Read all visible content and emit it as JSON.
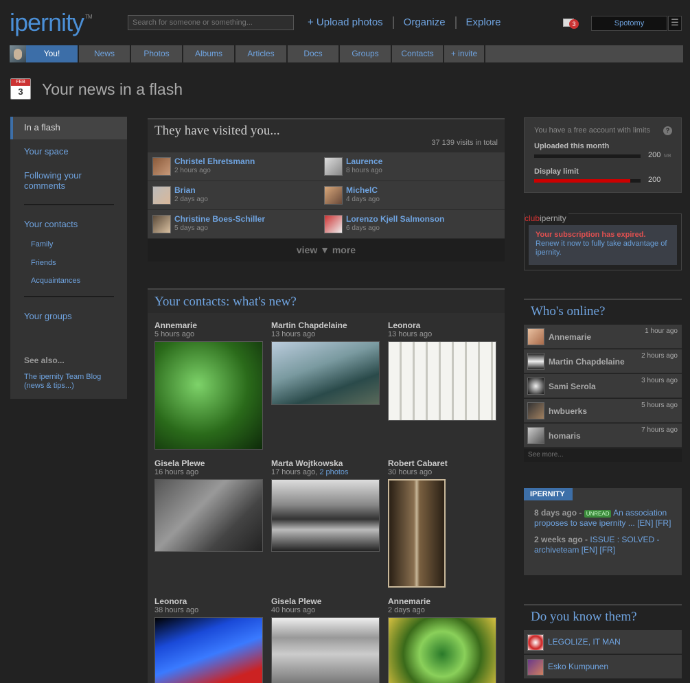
{
  "header": {
    "logo": "ipernity",
    "logo_tm": "TM",
    "search_placeholder": "Search for someone or something...",
    "nav": [
      "+ Upload photos",
      "Organize",
      "Explore"
    ],
    "mail_count": "3",
    "username": "Spotomy",
    "menu_glyph": "☰"
  },
  "tabs": [
    "You!",
    "News",
    "Photos",
    "Albums",
    "Articles",
    "Docs",
    "Groups",
    "Contacts",
    "+ invite"
  ],
  "page": {
    "cal_month": "FEB",
    "cal_day": "3",
    "title": "Your news in a flash"
  },
  "sidebar": {
    "items": [
      "In a flash",
      "Your space",
      "Following your comments",
      "Your contacts",
      "Your groups"
    ],
    "subitems": [
      "Family",
      "Friends",
      "Acquaintances"
    ],
    "see_also": "See also...",
    "blog": "The ipernity Team Blog (news & tips...)"
  },
  "visitors": {
    "title": "They have visited you...",
    "total": "37 139 visits in total",
    "list": [
      {
        "name": "Christel Ehretsmann",
        "time": "2 hours ago"
      },
      {
        "name": "Laurence",
        "time": "8 hours ago"
      },
      {
        "name": "Brian",
        "time": "2 days ago"
      },
      {
        "name": "MichelC",
        "time": "4 days ago"
      },
      {
        "name": "Christine Boes-Schiller",
        "time": "5 days ago"
      },
      {
        "name": "Lorenzo Kjell Salmonson",
        "time": "6 days ago"
      }
    ],
    "view_more": "view ▼ more"
  },
  "contacts": {
    "title": "Your contacts: what's new?",
    "photos": [
      {
        "name": "Annemarie",
        "time": "5 hours ago"
      },
      {
        "name": "Martin Chapdelaine",
        "time": "13 hours ago"
      },
      {
        "name": "Leonora",
        "time": "13 hours ago"
      },
      {
        "name": "Gisela Plewe",
        "time": "16 hours ago"
      },
      {
        "name": "Marta Wojtkowska",
        "time": "17 hours ago,",
        "extra": "2 photos"
      },
      {
        "name": "Robert Cabaret",
        "time": "30 hours ago"
      },
      {
        "name": "Leonora",
        "time": "38 hours ago"
      },
      {
        "name": "Gisela Plewe",
        "time": "40 hours ago"
      },
      {
        "name": "Annemarie",
        "time": "2 days ago"
      }
    ]
  },
  "account": {
    "note": "You have a free account with limits",
    "help": "?",
    "uploaded_label": "Uploaded this month",
    "uploaded_value": "200",
    "uploaded_unit": "MB",
    "uploaded_fraction": 0.0,
    "display_label": "Display limit",
    "display_value": "200",
    "display_fraction": 0.9
  },
  "club": {
    "logo_a": "club",
    "logo_b": "ipernity",
    "expired": "Your subscription has expired.",
    "renew": "Renew it now to fully take advantage of ipernity."
  },
  "online": {
    "title": "Who's online?",
    "users": [
      {
        "name": "Annemarie",
        "time": "1 hour ago"
      },
      {
        "name": "Martin Chapdelaine",
        "time": "2 hours ago"
      },
      {
        "name": "Sami Serola",
        "time": "3 hours ago"
      },
      {
        "name": "hwbuerks",
        "time": "5 hours ago"
      },
      {
        "name": "homaris",
        "time": "7 hours ago"
      }
    ],
    "see_more": "See more..."
  },
  "news": {
    "tab": "IPERNITY",
    "items": [
      {
        "when": "8 days ago -",
        "badge": "UNREAD",
        "text": "An association proposes to save ipernity ... [EN] [FR]"
      },
      {
        "when": "2 weeks ago -",
        "badge": "",
        "text": "ISSUE : SOLVED - archiveteam [EN] [FR]"
      }
    ]
  },
  "know": {
    "title": "Do you know them?",
    "people": [
      "LEGOLIZE, IT MAN",
      "Esko Kumpunen"
    ]
  },
  "colors": {
    "accent": "#6fa3df",
    "active_tab": "#3c6ea8",
    "alert": "#e05050",
    "bar_fill": "#cc0000"
  }
}
